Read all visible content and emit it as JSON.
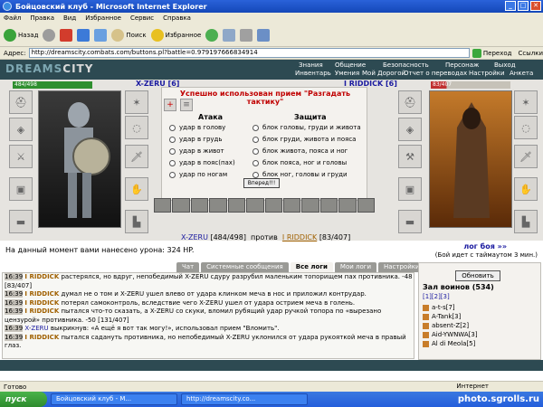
{
  "window": {
    "title": "Бойцовский клуб - Microsoft Internet Explorer"
  },
  "menu": [
    "Файл",
    "Правка",
    "Вид",
    "Избранное",
    "Сервис",
    "Справка"
  ],
  "toolbar": {
    "back": "Назад",
    "search": "Поиск",
    "favorites": "Избранное"
  },
  "address": {
    "label": "Адрес:",
    "url": "http://dreamscity.combats.com/buttons.pl?battle=0.979197666834914",
    "go": "Переход",
    "links": "Ссылки"
  },
  "game_nav": {
    "logo_a": "DREAMS",
    "logo_b": "CITY",
    "top": [
      "Знания",
      "Общение",
      "Безопасность",
      "Персонаж",
      "Выход"
    ],
    "bottom": [
      "Инвентарь",
      "Умения",
      "Мой Дорогой",
      "Отчет о переводах",
      "Настройки",
      "Анкета"
    ]
  },
  "left_fighter": {
    "name": "X-ZERU [6]",
    "hp": "484/498"
  },
  "right_fighter": {
    "name": "I RIDDICK [6]",
    "hp": "83/407"
  },
  "battle": {
    "success": "Успешно использован прием \"Разгадать тактику\"",
    "attack_header": "Атака",
    "defense_header": "Защита",
    "attacks": [
      "удар в голову",
      "удар в грудь",
      "удар в живот",
      "удар в пояс(пах)",
      "удар по ногам"
    ],
    "defenses": [
      "блок головы, груди и живота",
      "блок груди, живота и пояса",
      "блок живота, пояса и ног",
      "блок пояса, ног и головы",
      "блок ног, головы и груди"
    ],
    "forward": "Вперед!!!",
    "vs_left": "X-ZERU",
    "vs_left_hp": "[484/498]",
    "vs_word": "против",
    "vs_right": "I RIDDICK",
    "vs_right_hp": "[83/407]",
    "damage": "На данный момент вами нанесено урона: 324 HP.",
    "log_label": "лог боя »»",
    "timeout": "(Бой идет с таймаутом 3 мин.)"
  },
  "log_tabs": [
    "Чат",
    "Системные сообщения",
    "Все логи",
    "Мои логи",
    "Настройки"
  ],
  "log": [
    {
      "time": "16:39",
      "who": "I RIDDICK",
      "text": "растерялся, но вдруг, непобедимый X-ZERU сдуру разрубил маленьким топорищем пах противника. -48 [83/407]"
    },
    {
      "time": "16:39",
      "who": "I RIDDICK",
      "text": "думал не о том и X-ZERU ушел влево от удара клинком меча в нос и приложил контрудар."
    },
    {
      "time": "16:39",
      "who": "I RIDDICK",
      "text": "потерял самоконтроль, вследствие чего X-ZERU ушел от удара острием меча в голень."
    },
    {
      "time": "16:39",
      "who": "I RIDDICK",
      "text": "пытался что-то сказать, а X-ZERU со скуки, вломил рубящий удар ручкой топора по «вырезано цензурой» противника. -50 [131/407]"
    },
    {
      "time": "16:39",
      "who": "X-ZERU",
      "text": "выкрикнув: «А ещё я вот так могу!», использовал прием \"Вломить\"."
    },
    {
      "time": "16:39",
      "who": "I RIDDICK",
      "text": "пытался садануть противника, но непобедимый X-ZERU уклонился от удара рукояткой меча в правый глаз."
    }
  ],
  "side": {
    "refresh": "Обновить",
    "hall": "Зал воинов (534)",
    "pages": "[1][2][3]",
    "warriors": [
      "a-t-s[7]",
      "A-Tank[3]",
      "absent-Z[2]",
      "Aid-YWNWA[3]",
      "Al di Meola[5]"
    ]
  },
  "status": {
    "left": "Готово",
    "zone": "Интернет"
  },
  "taskbar": {
    "start": "пуск",
    "tasks": [
      "Бойцовский клуб - M...",
      "http://dreamscity.co..."
    ],
    "clock": "16:39"
  },
  "watermark": "photo.sgrolls.ru"
}
